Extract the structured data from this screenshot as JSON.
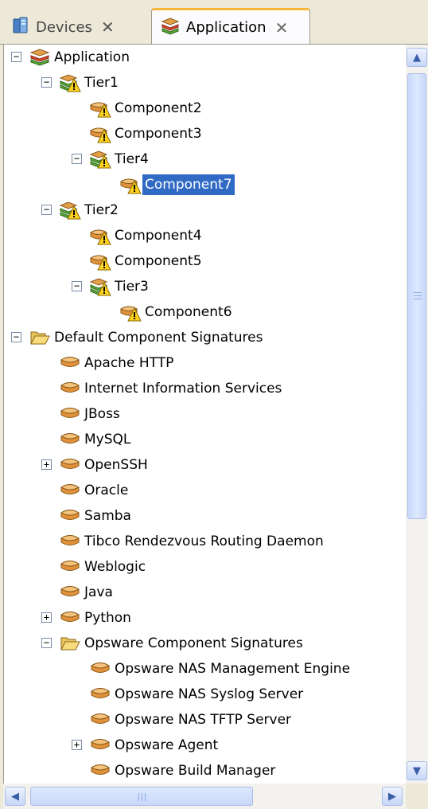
{
  "tabs": [
    {
      "label": "Devices",
      "icon": "devices-icon",
      "active": false
    },
    {
      "label": "Application",
      "icon": "application-stack-icon",
      "active": true
    }
  ],
  "tree": [
    {
      "label": "Application",
      "icon": "application-stack-icon",
      "level": 0,
      "expander": "minus"
    },
    {
      "label": "Tier1",
      "icon": "tier-warning-icon",
      "level": 1,
      "expander": "minus"
    },
    {
      "label": "Component2",
      "icon": "component-warning-icon",
      "level": 2,
      "expander": ""
    },
    {
      "label": "Component3",
      "icon": "component-warning-icon",
      "level": 2,
      "expander": ""
    },
    {
      "label": "Tier4",
      "icon": "tier-warning-icon",
      "level": 2,
      "expander": "minus"
    },
    {
      "label": "Component7",
      "icon": "component-warning-icon",
      "level": 3,
      "expander": "",
      "selected": true
    },
    {
      "label": "Tier2",
      "icon": "tier-warning-icon",
      "level": 1,
      "expander": "minus"
    },
    {
      "label": "Component4",
      "icon": "component-warning-icon",
      "level": 2,
      "expander": ""
    },
    {
      "label": "Component5",
      "icon": "component-warning-icon",
      "level": 2,
      "expander": ""
    },
    {
      "label": "Tier3",
      "icon": "tier-warning-icon",
      "level": 2,
      "expander": "minus"
    },
    {
      "label": "Component6",
      "icon": "component-warning-icon",
      "level": 3,
      "expander": ""
    },
    {
      "label": "Default Component Signatures",
      "icon": "open-folder-icon",
      "level": 0,
      "expander": "minus"
    },
    {
      "label": "Apache HTTP",
      "icon": "component-icon",
      "level": 1,
      "expander": ""
    },
    {
      "label": "Internet Information Services",
      "icon": "component-icon",
      "level": 1,
      "expander": ""
    },
    {
      "label": "JBoss",
      "icon": "component-icon",
      "level": 1,
      "expander": ""
    },
    {
      "label": "MySQL",
      "icon": "component-icon",
      "level": 1,
      "expander": ""
    },
    {
      "label": "OpenSSH",
      "icon": "component-icon",
      "level": 1,
      "expander": "plus"
    },
    {
      "label": "Oracle",
      "icon": "component-icon",
      "level": 1,
      "expander": ""
    },
    {
      "label": "Samba",
      "icon": "component-icon",
      "level": 1,
      "expander": ""
    },
    {
      "label": "Tibco Rendezvous Routing Daemon",
      "icon": "component-icon",
      "level": 1,
      "expander": ""
    },
    {
      "label": "Weblogic",
      "icon": "component-icon",
      "level": 1,
      "expander": ""
    },
    {
      "label": "Java",
      "icon": "component-icon",
      "level": 1,
      "expander": ""
    },
    {
      "label": "Python",
      "icon": "component-icon",
      "level": 1,
      "expander": "plus"
    },
    {
      "label": "Opsware Component Signatures",
      "icon": "open-folder-icon",
      "level": 1,
      "expander": "minus"
    },
    {
      "label": "Opsware NAS Management Engine",
      "icon": "component-icon",
      "level": 2,
      "expander": ""
    },
    {
      "label": "Opsware NAS Syslog Server",
      "icon": "component-icon",
      "level": 2,
      "expander": ""
    },
    {
      "label": "Opsware NAS TFTP Server",
      "icon": "component-icon",
      "level": 2,
      "expander": ""
    },
    {
      "label": "Opsware Agent",
      "icon": "component-icon",
      "level": 2,
      "expander": "plus"
    },
    {
      "label": "Opsware Build Manager",
      "icon": "component-icon",
      "level": 2,
      "expander": ""
    }
  ],
  "colors": {
    "selection": "#316ac5",
    "tab_accent": "#f6b73c",
    "scrollbar": "#c9d8fb"
  }
}
